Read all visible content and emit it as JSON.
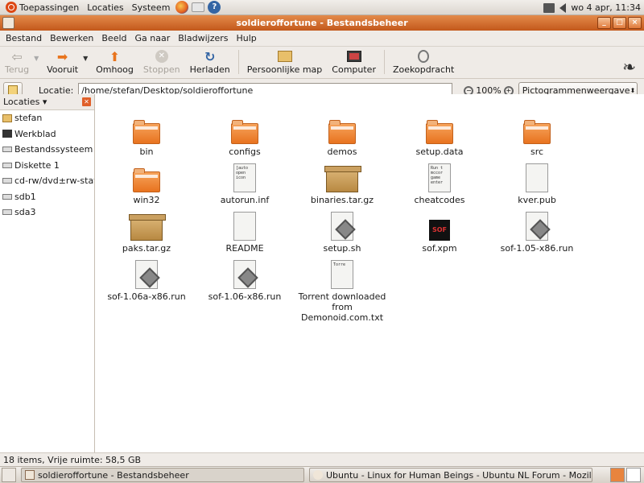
{
  "top_panel": {
    "menus": [
      "Toepassingen",
      "Locaties",
      "Systeem"
    ],
    "clock": "wo  4 apr, 11:34"
  },
  "window": {
    "title": "soldieroffortune - Bestandsbeheer",
    "controls": [
      "_",
      "□",
      "×"
    ]
  },
  "menubar": [
    "Bestand",
    "Bewerken",
    "Beeld",
    "Ga naar",
    "Bladwijzers",
    "Hulp"
  ],
  "toolbar": {
    "back": "Terug",
    "forward": "Vooruit",
    "up": "Omhoog",
    "stop": "Stoppen",
    "reload": "Herladen",
    "home": "Persoonlijke map",
    "computer": "Computer",
    "search": "Zoekopdracht"
  },
  "locationbar": {
    "label": "Locatie:",
    "path": "/home/stefan/Desktop/soldieroffortune",
    "zoom": "100%",
    "view": "Pictogrammenweergave"
  },
  "sidebar": {
    "header": "Locaties",
    "items": [
      "stefan",
      "Werkblad",
      "Bestandssysteem",
      "Diskette 1",
      "cd-rw/dvd±rw-statio",
      "sdb1",
      "sda3"
    ]
  },
  "files": [
    {
      "name": "bin",
      "type": "folder"
    },
    {
      "name": "configs",
      "type": "folder"
    },
    {
      "name": "demos",
      "type": "folder"
    },
    {
      "name": "setup.data",
      "type": "folder"
    },
    {
      "name": "src",
      "type": "folder"
    },
    {
      "name": "win32",
      "type": "folder"
    },
    {
      "name": "autorun.inf",
      "type": "text",
      "preview": "[auto\nopen\nicon"
    },
    {
      "name": "binaries.tar.gz",
      "type": "archive"
    },
    {
      "name": "cheatcodes",
      "type": "text",
      "preview": "Run t\nmccor\ngame\nenter"
    },
    {
      "name": "kver.pub",
      "type": "text",
      "preview": ""
    },
    {
      "name": "paks.tar.gz",
      "type": "archive"
    },
    {
      "name": "README",
      "type": "text",
      "preview": ""
    },
    {
      "name": "setup.sh",
      "type": "script"
    },
    {
      "name": "sof.xpm",
      "type": "image",
      "preview": "SOF"
    },
    {
      "name": "sof-1.05-x86.run",
      "type": "script"
    },
    {
      "name": "sof-1.06a-x86.run",
      "type": "script"
    },
    {
      "name": "sof-1.06-x86.run",
      "type": "script"
    },
    {
      "name": "Torrent downloaded from Demonoid.com.txt",
      "type": "text",
      "preview": "Torre"
    }
  ],
  "status": "18 items, Vrije ruimte: 58,5 GB",
  "taskbar": {
    "tasks": [
      "soldieroffortune - Bestandsbeheer",
      "Ubuntu - Linux for Human Beings - Ubuntu NL Forum - Mozilla ..."
    ]
  }
}
